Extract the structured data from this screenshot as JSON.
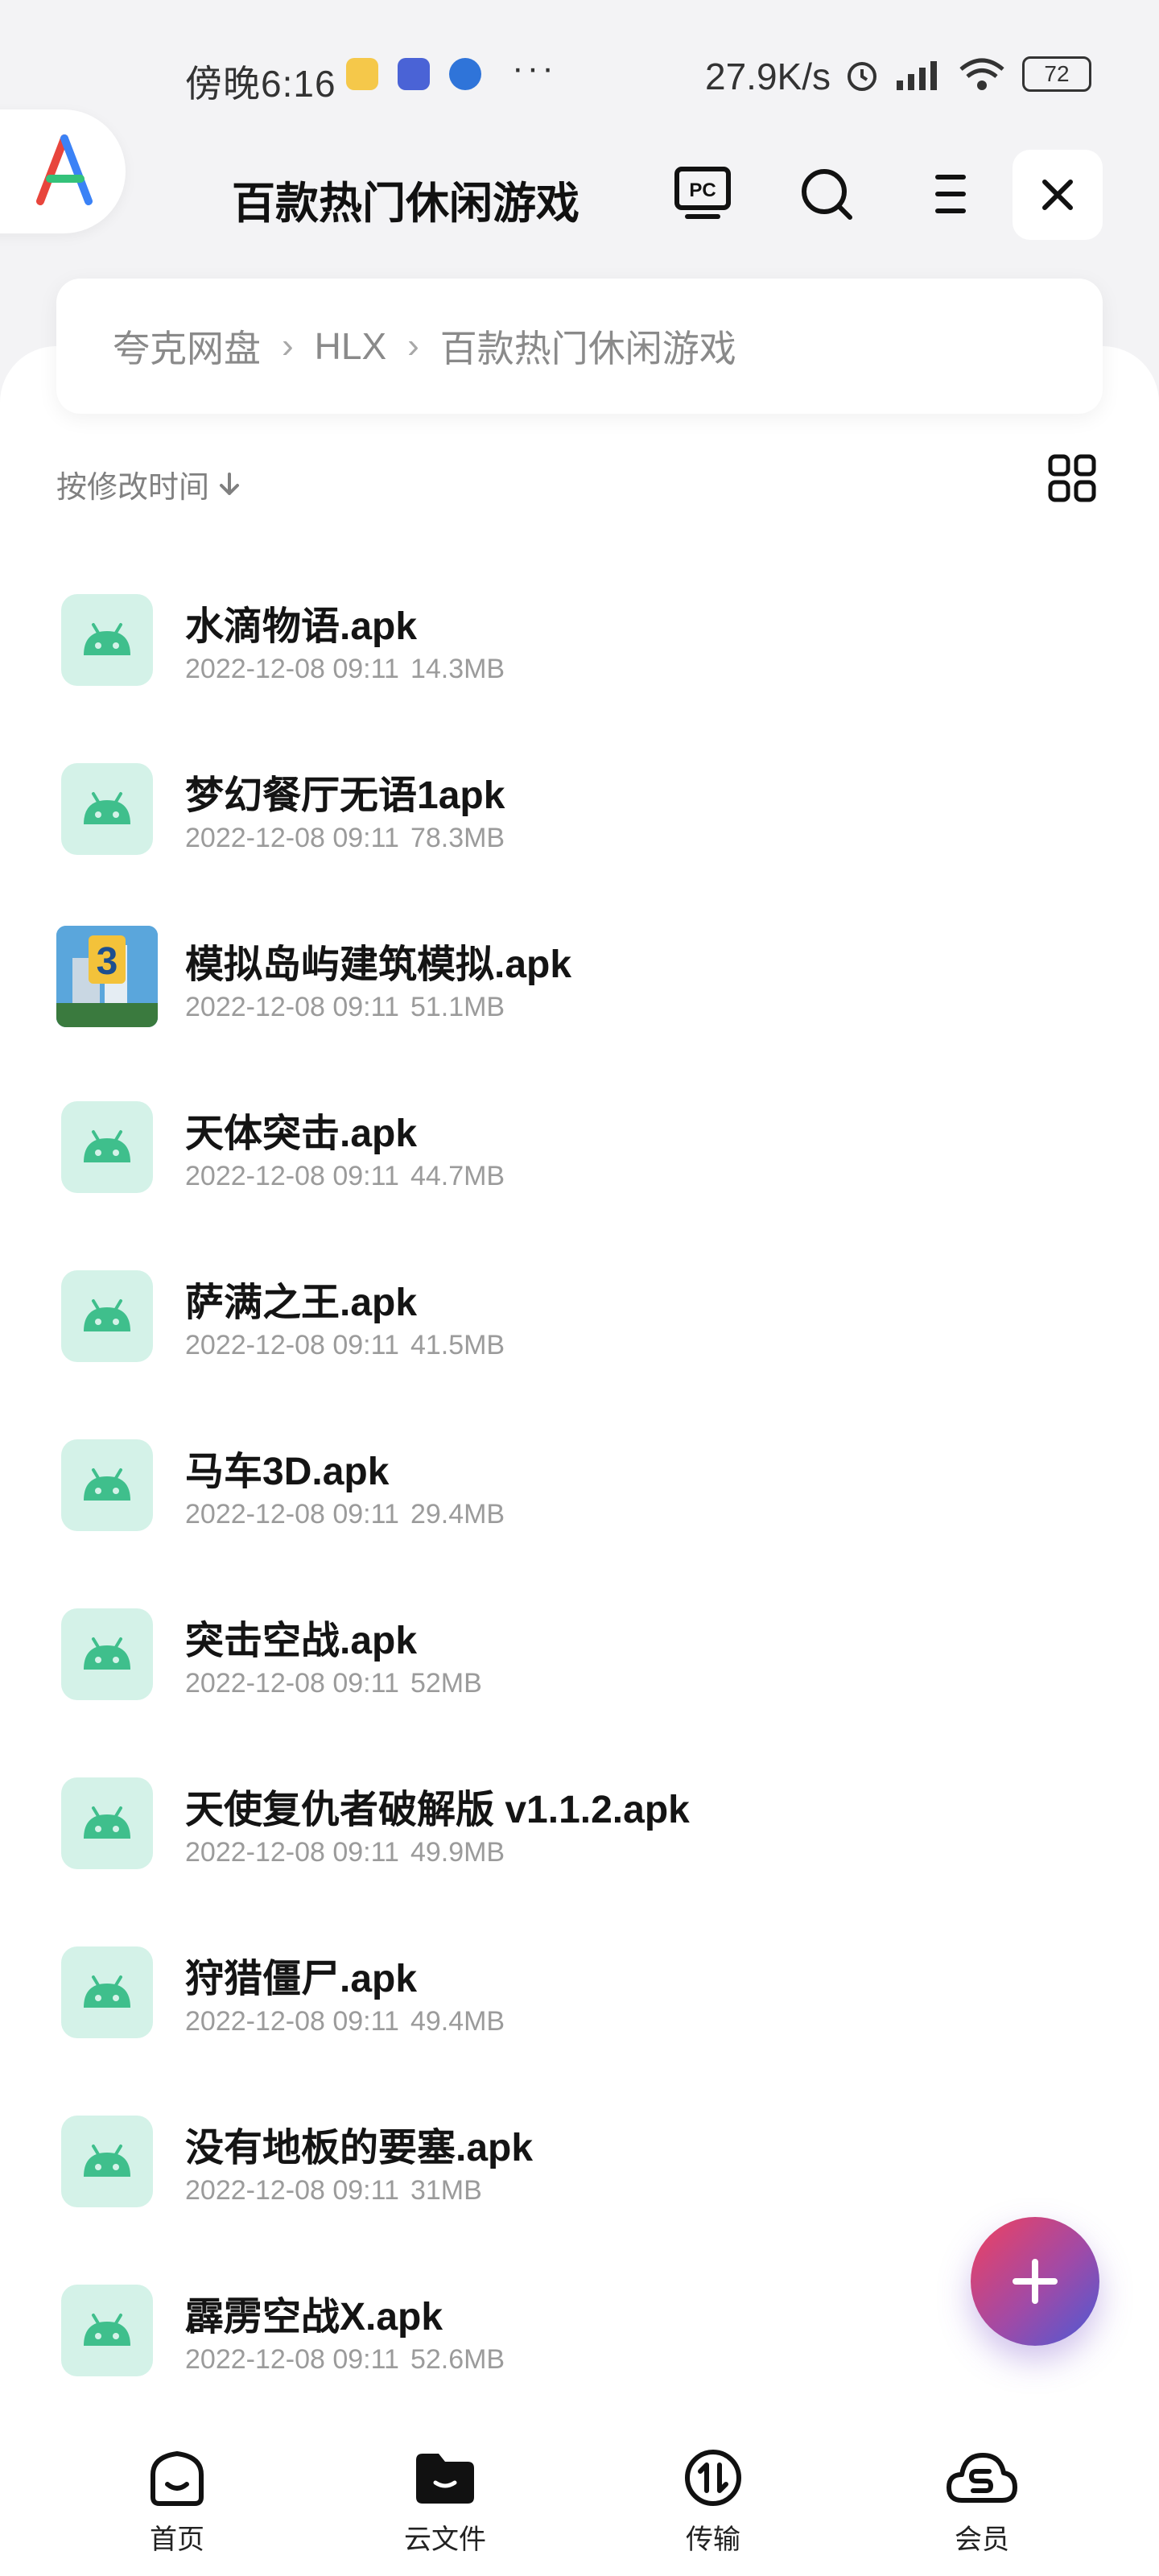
{
  "status_bar": {
    "time": "傍晚6:16",
    "more": "···",
    "net_speed": "27.9K/s",
    "battery": "72"
  },
  "header": {
    "title": "百款热门休闲游戏",
    "pc_label": "PC"
  },
  "breadcrumb": [
    "夸克网盘",
    "HLX",
    "百款热门休闲游戏"
  ],
  "sort": {
    "label": "按修改时间"
  },
  "files": [
    {
      "name": "水滴物语.apk",
      "date": "2022-12-08 09:11",
      "size": "14.3MB",
      "icon": "android-icon"
    },
    {
      "name": "梦幻餐厅无语1apk",
      "date": "2022-12-08 09:11",
      "size": "78.3MB",
      "icon": "android-icon"
    },
    {
      "name": "模拟岛屿建筑模拟.apk",
      "date": "2022-12-08 09:11",
      "size": "51.1MB",
      "icon": "app-thumbnail"
    },
    {
      "name": "天体突击.apk",
      "date": "2022-12-08 09:11",
      "size": "44.7MB",
      "icon": "android-icon"
    },
    {
      "name": "萨满之王.apk",
      "date": "2022-12-08 09:11",
      "size": "41.5MB",
      "icon": "android-icon"
    },
    {
      "name": "马车3D.apk",
      "date": "2022-12-08 09:11",
      "size": "29.4MB",
      "icon": "android-icon"
    },
    {
      "name": "突击空战.apk",
      "date": "2022-12-08 09:11",
      "size": "52MB",
      "icon": "android-icon"
    },
    {
      "name": "天使复仇者破解版 v1.1.2.apk",
      "date": "2022-12-08 09:11",
      "size": "49.9MB",
      "icon": "android-icon"
    },
    {
      "name": "狩猎僵尸.apk",
      "date": "2022-12-08 09:11",
      "size": "49.4MB",
      "icon": "android-icon"
    },
    {
      "name": "没有地板的要塞.apk",
      "date": "2022-12-08 09:11",
      "size": "31MB",
      "icon": "android-icon"
    },
    {
      "name": "霹雳空战X.apk",
      "date": "2022-12-08 09:11",
      "size": "52.6MB",
      "icon": "android-icon"
    }
  ],
  "bottom_nav": [
    {
      "label": "首页",
      "icon": "home-icon"
    },
    {
      "label": "云文件",
      "icon": "folder-icon",
      "active": true
    },
    {
      "label": "传输",
      "icon": "transfer-icon"
    },
    {
      "label": "会员",
      "icon": "vip-cloud-icon"
    }
  ],
  "colors": {
    "accent_android_bg": "#d4f2e8",
    "android_green": "#3fbf8c",
    "fab_gradient_start": "#f0415f",
    "fab_gradient_end": "#4a5ad6"
  }
}
